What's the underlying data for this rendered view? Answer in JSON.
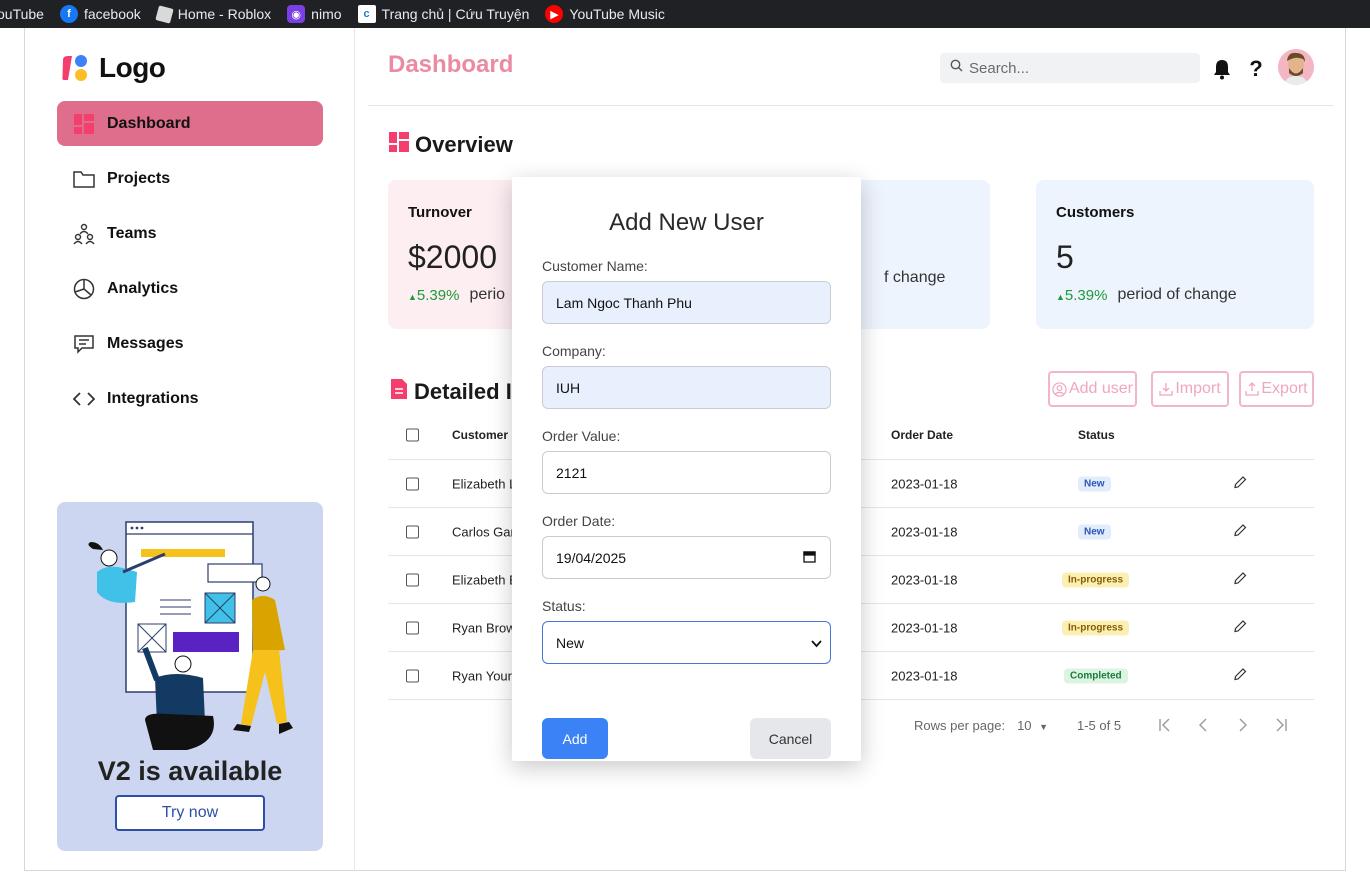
{
  "bookmarks": [
    {
      "label": "ouTube",
      "icon": "youtube-icon"
    },
    {
      "label": "facebook",
      "icon": "facebook-icon"
    },
    {
      "label": "Home - Roblox",
      "icon": "roblox-icon"
    },
    {
      "label": "nimo",
      "icon": "nimo-icon"
    },
    {
      "label": "Trang chủ | Cứu Truyện",
      "icon": "cuutruyen-icon"
    },
    {
      "label": "YouTube Music",
      "icon": "youtube-music-icon"
    }
  ],
  "logo": {
    "text": "Logo"
  },
  "nav": [
    {
      "label": "Dashboard",
      "icon": "dashboard-grid-icon",
      "active": true
    },
    {
      "label": "Projects",
      "icon": "folder-icon"
    },
    {
      "label": "Teams",
      "icon": "teams-icon"
    },
    {
      "label": "Analytics",
      "icon": "pie-chart-icon"
    },
    {
      "label": "Messages",
      "icon": "message-icon"
    },
    {
      "label": "Integrations",
      "icon": "code-icon"
    }
  ],
  "promo": {
    "title": "V2 is available",
    "button": "Try now"
  },
  "header": {
    "title": "Dashboard",
    "search_placeholder": "Search..."
  },
  "overview": {
    "title": "Overview",
    "cards": [
      {
        "label": "Turnover",
        "value": "$2000",
        "pct": "5.39%",
        "change_text": "perio"
      },
      {
        "label": "",
        "value": "",
        "pct": "",
        "change_text": "f change"
      },
      {
        "label": "Customers",
        "value": "5",
        "pct": "5.39%",
        "change_text": "period of change"
      }
    ]
  },
  "report": {
    "title": "Detailed I",
    "buttons": {
      "add_user": "Add user",
      "import": "Import",
      "export": "Export"
    },
    "columns": {
      "customer": "Customer N",
      "order_date": "Order Date",
      "status": "Status"
    },
    "rows": [
      {
        "customer": "Elizabeth L",
        "order_date": "2023-01-18",
        "status": "New"
      },
      {
        "customer": "Carlos Gar",
        "order_date": "2023-01-18",
        "status": "New"
      },
      {
        "customer": "Elizabeth E",
        "order_date": "2023-01-18",
        "status": "In-progress"
      },
      {
        "customer": "Ryan Brow",
        "order_date": "2023-01-18",
        "status": "In-progress"
      },
      {
        "customer": "Ryan Youn",
        "order_date": "2023-01-18",
        "status": "Completed"
      }
    ],
    "pager": {
      "rows_label": "Rows per page:",
      "rows_value": "10",
      "range": "1-5 of 5"
    }
  },
  "modal": {
    "title": "Add New User",
    "fields": {
      "customer_name": {
        "label": "Customer Name:",
        "value": "Lam Ngoc Thanh Phu"
      },
      "company": {
        "label": "Company:",
        "value": "IUH"
      },
      "order_value": {
        "label": "Order Value:",
        "value": "2121"
      },
      "order_date": {
        "label": "Order Date:",
        "value": "19/04/2025"
      },
      "status": {
        "label": "Status:",
        "value": "New"
      }
    },
    "add": "Add",
    "cancel": "Cancel"
  },
  "colors": {
    "accent_pink": "#de6e8c",
    "title_pink": "#ea8aa3",
    "primary_blue": "#3b82f6",
    "promo_bg": "#cdd6f0",
    "positive_green": "#1f9a3a"
  }
}
